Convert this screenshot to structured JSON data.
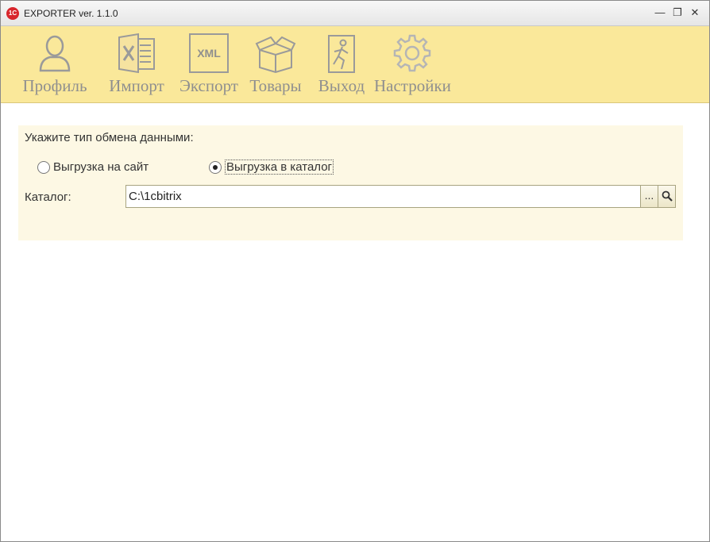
{
  "window": {
    "title": "EXPORTER ver. 1.1.0",
    "app_icon_text": "1C",
    "controls": {
      "minimize": "—",
      "restore": "❐",
      "close": "✕"
    }
  },
  "toolbar": {
    "items": [
      {
        "label": "Профиль",
        "icon": "user-icon"
      },
      {
        "label": "Импорт",
        "icon": "excel-icon"
      },
      {
        "label": "Экспорт",
        "icon": "xml-icon",
        "icon_text": "XML"
      },
      {
        "label": "Товары",
        "icon": "box-icon"
      },
      {
        "label": "Выход",
        "icon": "exit-icon"
      },
      {
        "label": "Настройки",
        "icon": "gear-icon"
      }
    ]
  },
  "exchange": {
    "prompt": "Укажите тип обмена данными:",
    "options": [
      {
        "label": "Выгрузка на сайт",
        "selected": false
      },
      {
        "label": "Выгрузка в каталог",
        "selected": true
      }
    ],
    "catalog_label": "Каталог:",
    "catalog_value": "C:\\1cbitrix",
    "browse_button": "...",
    "search_icon": "search-icon"
  },
  "colors": {
    "toolbar_bg": "#fae89a",
    "panel_bg": "#fdf8e4",
    "icon_gray": "#9a9a9a"
  }
}
